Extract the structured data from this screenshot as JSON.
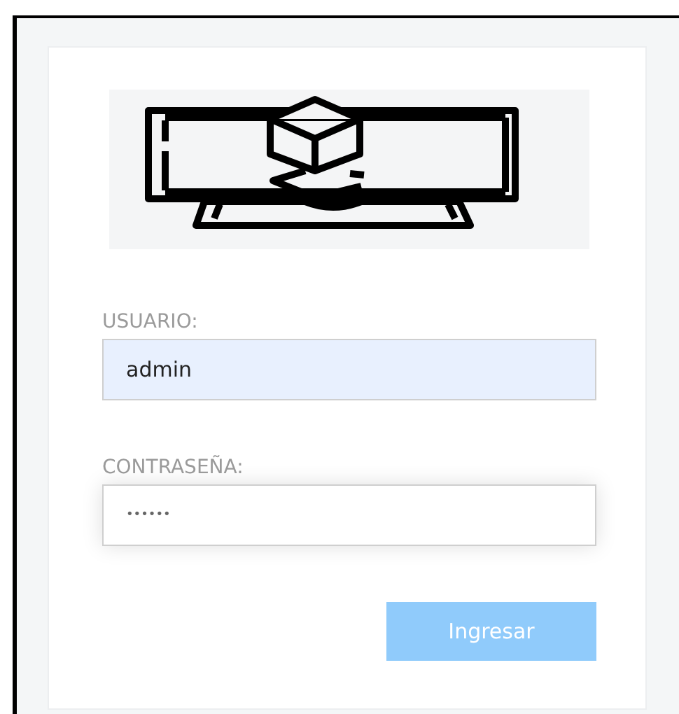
{
  "form": {
    "fields": [
      {
        "label": "USUARIO:",
        "value": "admin",
        "autofilled": true,
        "focused": false
      },
      {
        "label": "CONTRASEÑA:",
        "value": "••••••",
        "autofilled": false,
        "focused": true
      }
    ],
    "button": {
      "label": "Ingresar",
      "disabled": true
    }
  }
}
